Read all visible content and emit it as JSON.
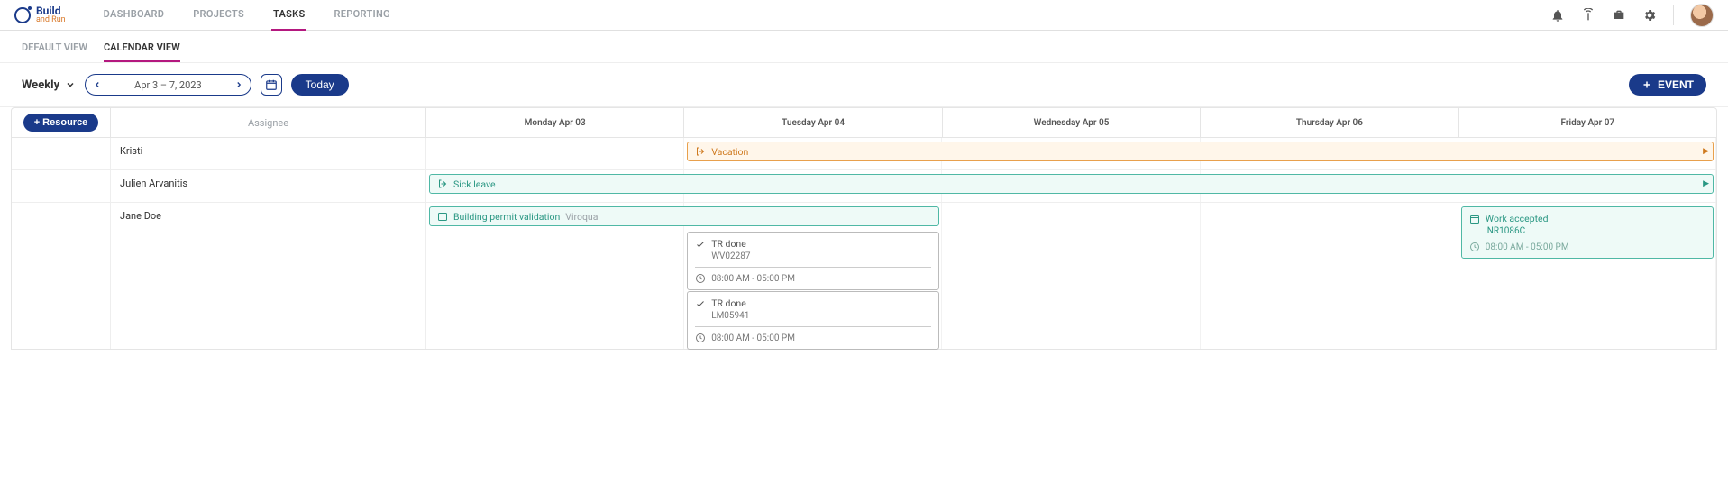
{
  "brand": {
    "line1": "Build",
    "line2": "and Run"
  },
  "nav": {
    "dashboard": "DASHBOARD",
    "projects": "PROJECTS",
    "tasks": "TASKS",
    "reporting": "REPORTING"
  },
  "subnav": {
    "default_view": "DEFAULT VIEW",
    "calendar_view": "CALENDAR VIEW"
  },
  "toolbar": {
    "mode": "Weekly",
    "range": "Apr 3 – 7, 2023",
    "today": "Today",
    "event": "EVENT"
  },
  "columns": {
    "add_resource": "+ Resource",
    "assignee": "Assignee",
    "days": [
      "Monday Apr 03",
      "Tuesday Apr 04",
      "Wednesday Apr 05",
      "Thursday Apr 06",
      "Friday Apr 07"
    ]
  },
  "rows": [
    {
      "assignee": "Kristi",
      "events": [
        {
          "kind": "vacation",
          "label": "Vacation",
          "startDay": 1,
          "endDay": 5,
          "continues": true
        }
      ]
    },
    {
      "assignee": "Julien Arvanitis",
      "events": [
        {
          "kind": "sick",
          "label": "Sick leave",
          "startDay": 0,
          "endDay": 5,
          "continues": true
        }
      ]
    },
    {
      "assignee": "Jane Doe",
      "events": [
        {
          "kind": "permit",
          "label": "Building permit validation",
          "sub": "Viroqua",
          "startDay": 0,
          "endDay": 2
        },
        {
          "kind": "task",
          "title": "TR done",
          "ref": "WV02287",
          "time": "08:00 AM - 05:00 PM",
          "startDay": 1,
          "endDay": 2,
          "slot": 0
        },
        {
          "kind": "task",
          "title": "TR done",
          "ref": "LM05941",
          "time": "08:00 AM - 05:00 PM",
          "startDay": 1,
          "endDay": 2,
          "slot": 1
        },
        {
          "kind": "work",
          "label": "Work accepted",
          "ref": "NR1086C",
          "time": "08:00 AM - 05:00 PM",
          "startDay": 4,
          "endDay": 5
        }
      ]
    }
  ]
}
